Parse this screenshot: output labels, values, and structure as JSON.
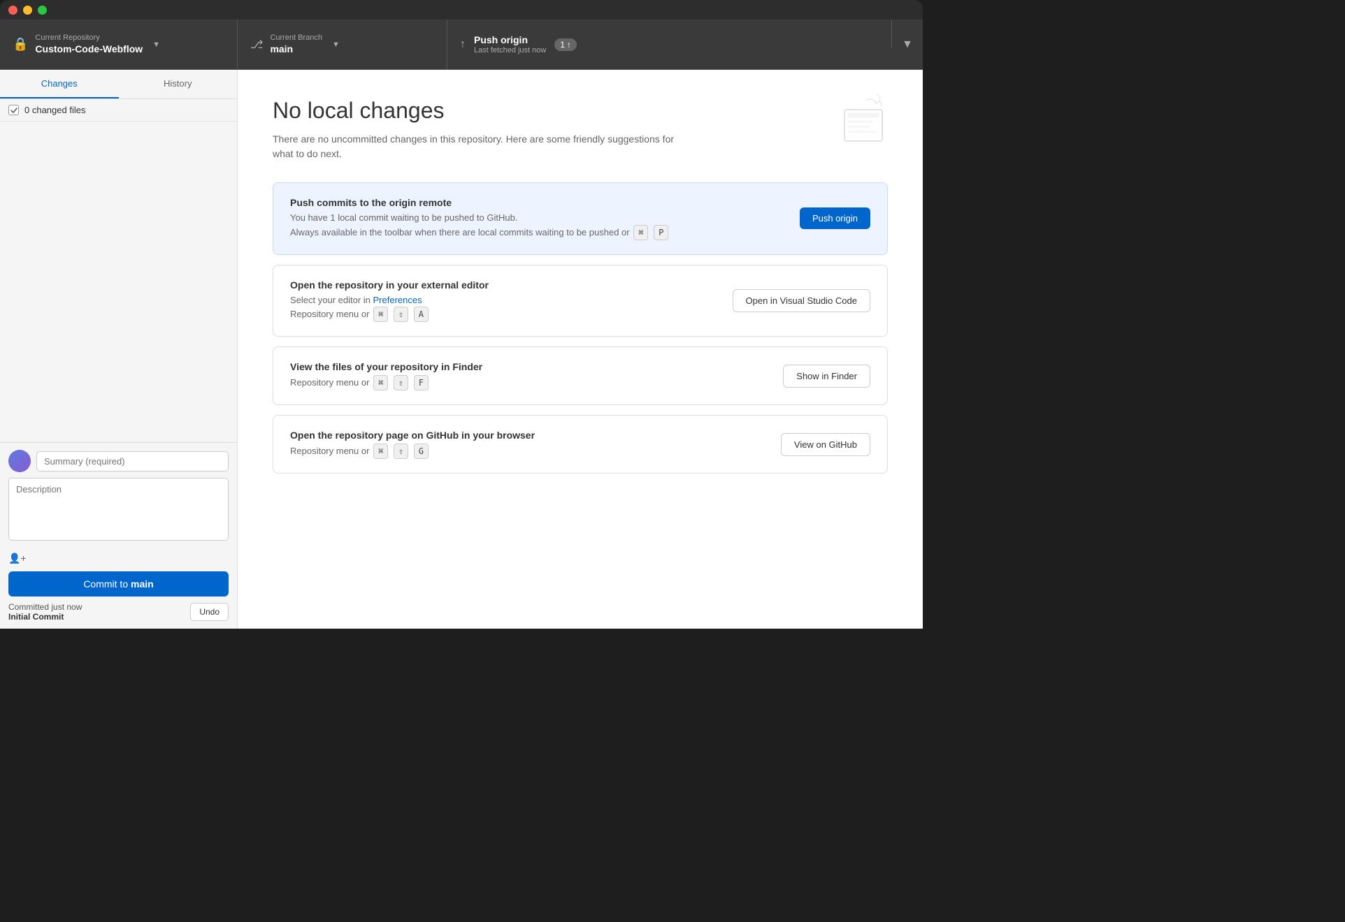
{
  "titlebar": {
    "lights": [
      "red",
      "yellow",
      "green"
    ]
  },
  "toolbar": {
    "repo_label": "Current Repository",
    "repo_name": "Custom-Code-Webflow",
    "branch_label": "Current Branch",
    "branch_name": "main",
    "push_label": "Push origin",
    "push_sublabel": "Last fetched just now",
    "push_count": "1",
    "push_arrow": "↑"
  },
  "sidebar": {
    "tab_changes": "Changes",
    "tab_history": "History",
    "changed_files_count": "0 changed files"
  },
  "commit": {
    "summary_placeholder": "Summary (required)",
    "description_placeholder": "Description",
    "coauthors_label": "Add co-authors",
    "button_label": "Commit to",
    "branch_name": "main",
    "committed_time": "Committed just now",
    "committed_message": "Initial Commit",
    "undo_label": "Undo"
  },
  "main": {
    "no_changes_title": "No local changes",
    "no_changes_subtitle": "There are no uncommitted changes in this repository. Here are some friendly suggestions for what to do next.",
    "cards": [
      {
        "id": "push",
        "title": "Push commits to the origin remote",
        "desc_line1": "You have 1 local commit waiting to be pushed to GitHub.",
        "desc_line2": "Always available in the toolbar when there are local commits waiting to be pushed or",
        "kbd1": "⌘",
        "kbd2": "P",
        "button_label": "Push origin",
        "button_type": "primary",
        "highlighted": true
      },
      {
        "id": "editor",
        "title": "Open the repository in your external editor",
        "desc_line1": "Select your editor in",
        "preferences_link": "Preferences",
        "desc_line2": "Repository menu or",
        "kbd1": "⌘",
        "kbd2": "⇧",
        "kbd3": "A",
        "button_label": "Open in Visual Studio Code",
        "button_type": "secondary",
        "highlighted": false
      },
      {
        "id": "finder",
        "title": "View the files of your repository in Finder",
        "desc_line1": "Repository menu or",
        "kbd1": "⌘",
        "kbd2": "⇧",
        "kbd3": "F",
        "button_label": "Show in Finder",
        "button_type": "secondary",
        "highlighted": false
      },
      {
        "id": "github",
        "title": "Open the repository page on GitHub in your browser",
        "desc_line1": "Repository menu or",
        "kbd1": "⌘",
        "kbd2": "⇧",
        "kbd3": "G",
        "button_label": "View on GitHub",
        "button_type": "secondary",
        "highlighted": false
      }
    ]
  }
}
